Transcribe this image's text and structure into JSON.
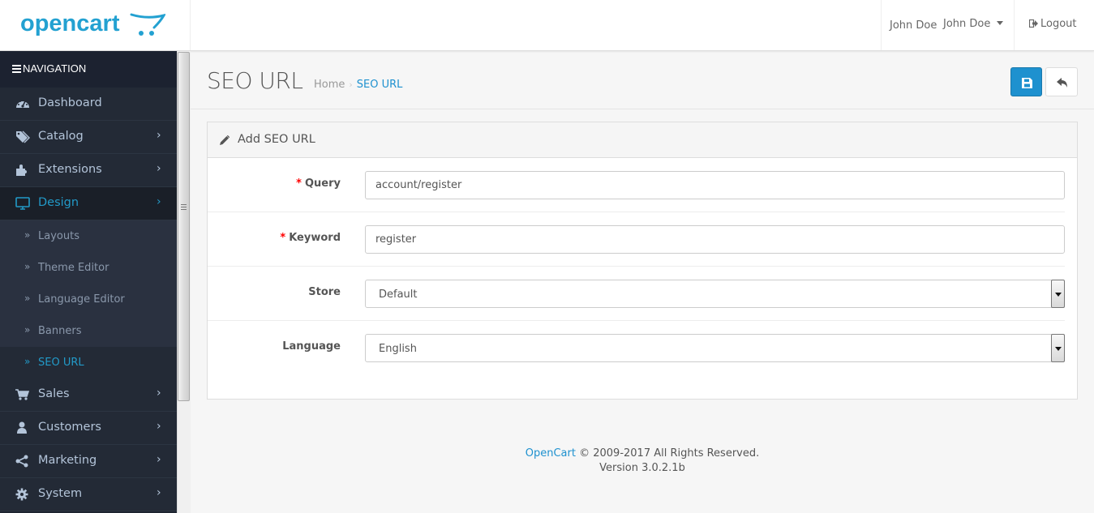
{
  "header": {
    "logo_text": "opencart",
    "user_name": "John Doe",
    "user_dropdown_label": "John Doe",
    "logout_label": "Logout"
  },
  "sidebar": {
    "heading": "NAVIGATION",
    "items": [
      {
        "label": "Dashboard",
        "icon": "dashboard-icon",
        "has_children": false
      },
      {
        "label": "Catalog",
        "icon": "tags-icon",
        "has_children": true
      },
      {
        "label": "Extensions",
        "icon": "puzzle-icon",
        "has_children": true
      },
      {
        "label": "Design",
        "icon": "monitor-icon",
        "has_children": true,
        "active": true
      },
      {
        "label": "Sales",
        "icon": "shopping-cart-icon",
        "has_children": true
      },
      {
        "label": "Customers",
        "icon": "user-icon",
        "has_children": true
      },
      {
        "label": "Marketing",
        "icon": "share-icon",
        "has_children": true
      },
      {
        "label": "System",
        "icon": "gear-icon",
        "has_children": true
      }
    ],
    "design_children": [
      {
        "label": "Layouts"
      },
      {
        "label": "Theme Editor"
      },
      {
        "label": "Language Editor"
      },
      {
        "label": "Banners"
      },
      {
        "label": "SEO URL",
        "active": true
      }
    ],
    "chevron": "›",
    "sub_bullet": "»"
  },
  "page": {
    "title": "SEO URL",
    "breadcrumb": [
      {
        "label": "Home"
      },
      {
        "label": "SEO URL"
      }
    ],
    "breadcrumb_sep": "›",
    "save_button_icon": "save-icon",
    "back_button_icon": "reply-icon"
  },
  "panel": {
    "title": "Add SEO URL",
    "fields": {
      "query": {
        "label": "Query",
        "required": true,
        "value": "account/register"
      },
      "keyword": {
        "label": "Keyword",
        "required": true,
        "value": "register"
      },
      "store": {
        "label": "Store",
        "selected": "Default"
      },
      "language": {
        "label": "Language",
        "selected": "English"
      }
    },
    "required_marker": "*"
  },
  "footer": {
    "brand": "OpenCart",
    "copyright": " © 2009-2017 All Rights Reserved.",
    "version": "Version 3.0.2.1b"
  },
  "colors": {
    "accent": "#1e91cf",
    "logo": "#23a1d1",
    "sidebar_bg": "#232a36",
    "required": "#ff0000"
  }
}
